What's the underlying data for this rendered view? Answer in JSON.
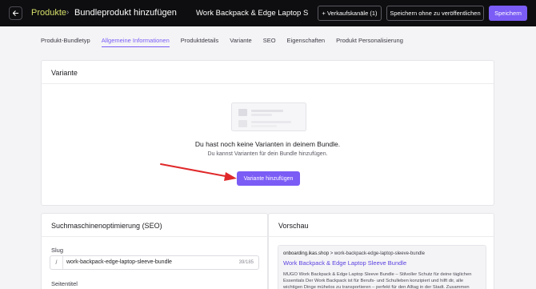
{
  "header": {
    "back_icon": "arrow-left-icon",
    "breadcrumb_root": "Produkte",
    "breadcrumb_separator": "›",
    "breadcrumb_current": "Bundleprodukt hinzufügen",
    "product_name": "Work Backpack & Edge Laptop Sle",
    "channels_button": "+ Verkaufskanäle (1)",
    "save_without_publish_button": "Speichern ohne zu veröffentlichen",
    "save_button": "Speichern",
    "accent_color": "#7b5cf5",
    "breadcrumb_color": "#d7e06a"
  },
  "tabs": [
    {
      "label": "Produkt-Bundletyp",
      "active": false
    },
    {
      "label": "Allgemeine Informationen",
      "active": true
    },
    {
      "label": "Produktdetails",
      "active": false
    },
    {
      "label": "Variante",
      "active": false
    },
    {
      "label": "SEO",
      "active": false
    },
    {
      "label": "Eigenschaften",
      "active": false
    },
    {
      "label": "Produkt Personalisierung",
      "active": false
    }
  ],
  "variante": {
    "title": "Variante",
    "empty_title": "Du hast noch keine Varianten in deinem Bundle.",
    "empty_subtitle": "Du kannst Varianten für dein Bundle hinzufügen.",
    "add_button": "Variante hinzufügen"
  },
  "seo": {
    "title": "Suchmaschinenoptimierung (SEO)",
    "slug_label": "Slug",
    "slug_prefix": "/",
    "slug_value": "work-backpack-edge-laptop-sleeve-bundle",
    "slug_count": "39/185",
    "seitentitel_label": "Seitentitel"
  },
  "preview": {
    "title": "Vorschau",
    "domain": "onboarding.ikas.shop",
    "path": " > work-backpack-edge-laptop-sleeve-bundle",
    "link_title": "Work Backpack & Edge Laptop Sleeve Bundle",
    "description": "MUGO Work Backpack & Edge Laptop Sleeve Bundle – Stilvoller Schutz für deine täglichen Essentials Der Work Backpack ist für Berufs- und Schulleben konzipiert und hilft dir, alle wichtigen Dinge mühelos zu transportieren – perfekt für den Alltag in der Stadt. Zusammen"
  }
}
